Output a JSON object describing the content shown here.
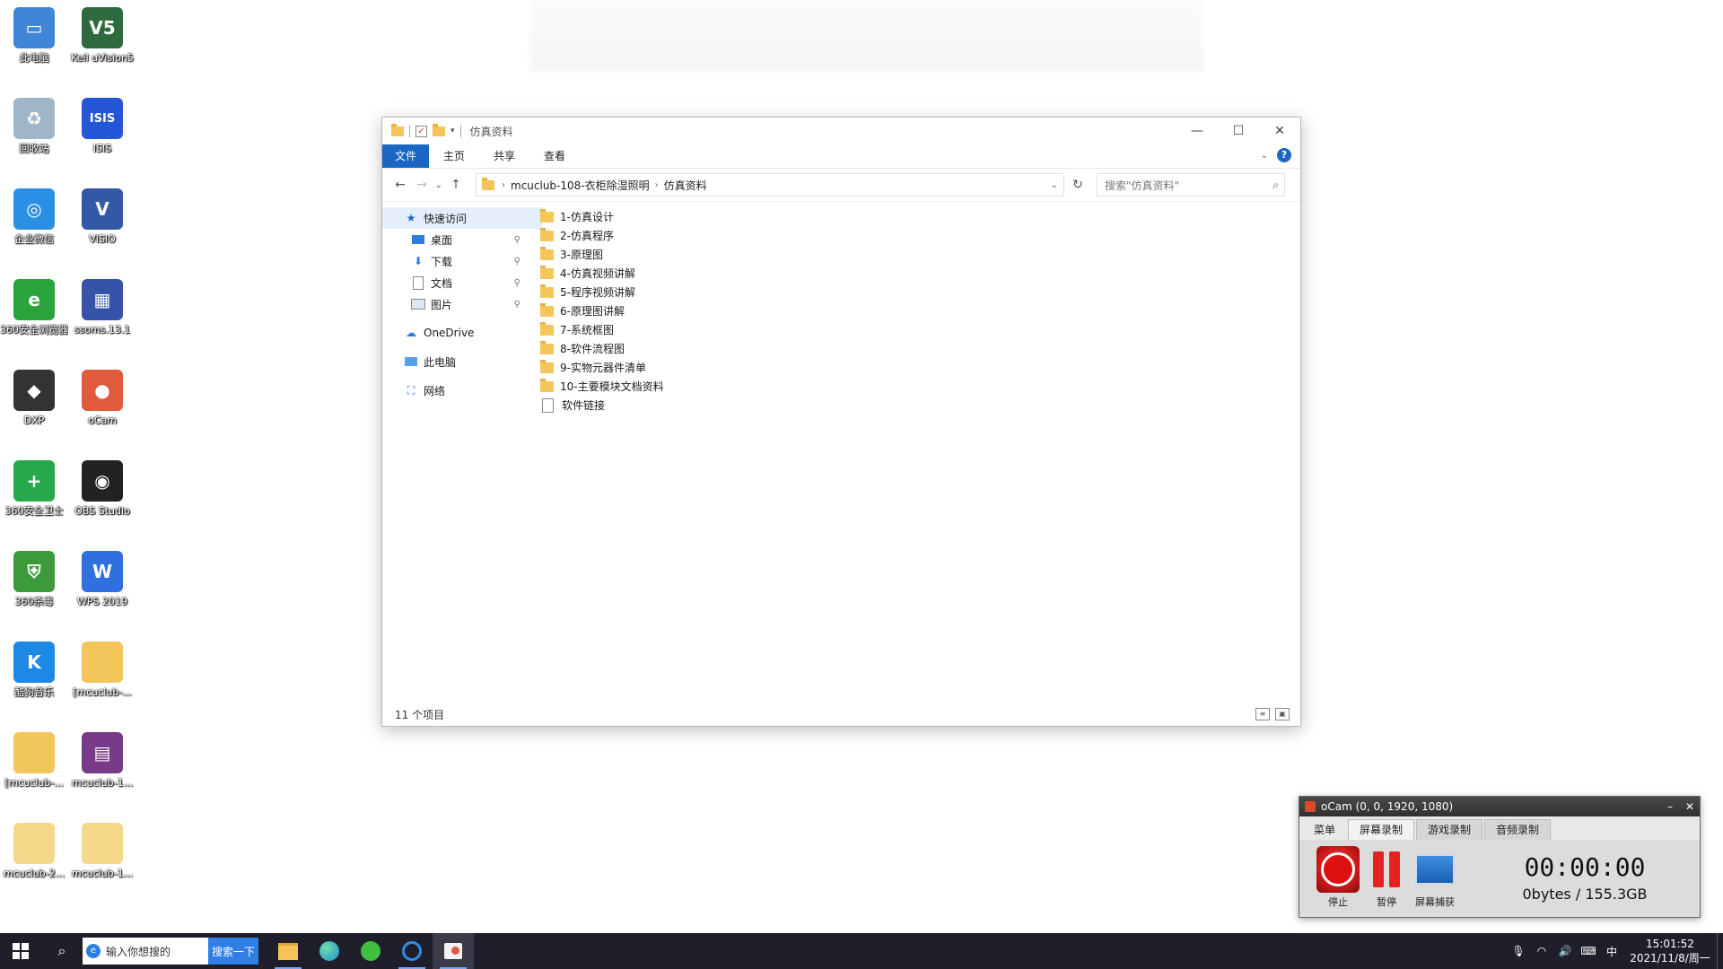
{
  "desktop": {
    "icons": [
      {
        "label": "此电脑",
        "color": "#3f86d6",
        "glyph": "▭"
      },
      {
        "label": "Keil uVision5",
        "color": "#2d6a3e",
        "glyph": "V5"
      },
      {
        "label": "回收站",
        "color": "#9fb6c8",
        "glyph": "♻"
      },
      {
        "label": "ISIS",
        "color": "#2456d8",
        "glyph": "ISIS"
      },
      {
        "label": "企业微信",
        "color": "#2b8fe3",
        "glyph": "◎"
      },
      {
        "label": "VISIO",
        "color": "#3458a8",
        "glyph": "V"
      },
      {
        "label": "360安全浏览器",
        "color": "#2aa33a",
        "glyph": "e"
      },
      {
        "label": "ssoms.13.1",
        "color": "#3553a8",
        "glyph": "▦"
      },
      {
        "label": "DXP",
        "color": "#333333",
        "glyph": "◆"
      },
      {
        "label": "oCam",
        "color": "#e05a3c",
        "glyph": "●"
      },
      {
        "label": "360安全卫士",
        "color": "#27a84a",
        "glyph": "+"
      },
      {
        "label": "OBS Studio",
        "color": "#222222",
        "glyph": "◉"
      },
      {
        "label": "360杀毒",
        "color": "#3d9a3a",
        "glyph": "⛨"
      },
      {
        "label": "WPS 2019",
        "color": "#2f6fe0",
        "glyph": "W"
      },
      {
        "label": "酷狗音乐",
        "color": "#1e88e5",
        "glyph": "K"
      },
      {
        "label": "[mcuclub-...",
        "color": "#f3c65b",
        "glyph": ""
      },
      {
        "label": "[mcuclub-...",
        "color": "#f3c65b",
        "glyph": ""
      },
      {
        "label": "mcuclub-1...",
        "color": "#7a3a8a",
        "glyph": "▤"
      },
      {
        "label": "mcuclub-2...",
        "color": "#f6d88a",
        "glyph": ""
      },
      {
        "label": "mcuclub-1...",
        "color": "#f6d88a",
        "glyph": ""
      }
    ]
  },
  "explorer": {
    "title": "仿真资料",
    "ribbon": {
      "file": "文件",
      "home": "主页",
      "share": "共享",
      "view": "查看"
    },
    "address": {
      "crumb1": "mcuclub-108-衣柜除湿照明",
      "crumb2": "仿真资料"
    },
    "search_placeholder": "搜索\"仿真资料\"",
    "nav": {
      "quick_access": "快速访问",
      "desktop": "桌面",
      "downloads": "下载",
      "documents": "文档",
      "pictures": "图片",
      "onedrive": "OneDrive",
      "this_pc": "此电脑",
      "network": "网络"
    },
    "files": [
      {
        "name": "1-仿真设计",
        "type": "folder"
      },
      {
        "name": "2-仿真程序",
        "type": "folder"
      },
      {
        "name": "3-原理图",
        "type": "folder"
      },
      {
        "name": "4-仿真视频讲解",
        "type": "folder"
      },
      {
        "name": "5-程序视频讲解",
        "type": "folder"
      },
      {
        "name": "6-原理图讲解",
        "type": "folder"
      },
      {
        "name": "7-系统框图",
        "type": "folder"
      },
      {
        "name": "8-软件流程图",
        "type": "folder"
      },
      {
        "name": "9-实物元器件清单",
        "type": "folder"
      },
      {
        "name": "10-主要模块文档资料",
        "type": "folder"
      },
      {
        "name": "软件链接",
        "type": "file"
      }
    ],
    "status": "11 个项目"
  },
  "ocam": {
    "title": "oCam (0, 0, 1920, 1080)",
    "tabs": {
      "menu": "菜单",
      "screen": "屏幕录制",
      "game": "游戏录制",
      "audio": "音频录制"
    },
    "buttons": {
      "stop": "停止",
      "pause": "暂停",
      "capture": "屏幕捕获"
    },
    "time": "00:00:00",
    "size": "0bytes / 155.3GB"
  },
  "taskbar": {
    "search_text": "输入你想搜的",
    "search_button": "搜索一下",
    "ime": "中",
    "time": "15:01:52",
    "date": "2021/11/8/周一"
  }
}
